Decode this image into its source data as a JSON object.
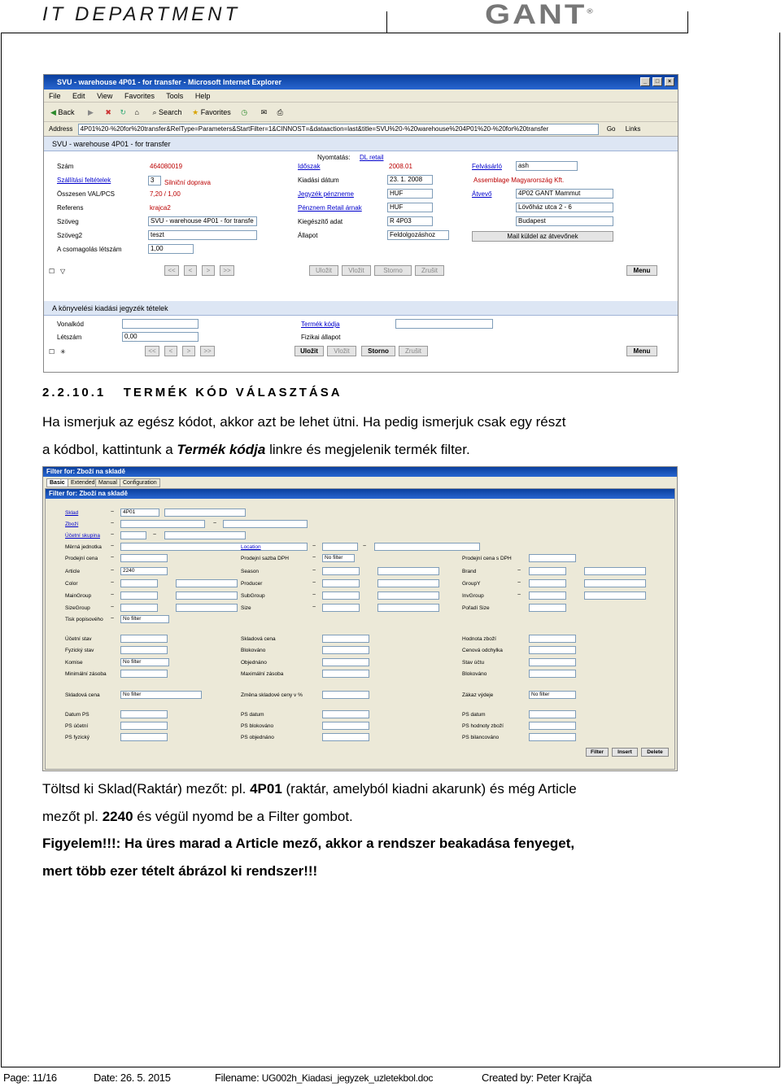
{
  "header": {
    "title": "IT DEPARTMENT",
    "logo": "GANT",
    "logo_reg": "®"
  },
  "shot1": {
    "window_title": "SVU - warehouse 4P01 - for transfer - Microsoft Internet Explorer",
    "menu": [
      "File",
      "Edit",
      "View",
      "Favorites",
      "Tools",
      "Help"
    ],
    "toolbar": [
      "Back",
      "Search",
      "Favorites"
    ],
    "address_label": "Address",
    "address_url": "4P01%20-%20for%20transfer&RelType=Parameters&StartFilter=1&CINNOST=&dataaction=last&title=SVU%20-%20warehouse%204P01%20-%20for%20transfer",
    "go": "Go",
    "links": "Links",
    "panel1_title": "SVU - warehouse 4P01 - for transfer",
    "print_label": "Nyomtatás:",
    "print_link": "DL retail",
    "left_labels": [
      "Szám",
      "Szállítási feltételek",
      "Összesen VAL/PCS",
      "Referens",
      "Szöveg",
      "Szöveg2",
      "A csomagolás létszám"
    ],
    "left_values": [
      "464080019",
      "3",
      "7,20 / 1,00",
      "krajca2",
      "SVU - warehouse 4P01 - for transfe",
      "teszt",
      "1,00"
    ],
    "left_extra": "Silniční doprava",
    "mid_labels": [
      "Időszak",
      "Kiadási dátum",
      "Jegyzék pénzneme",
      "Pénznem Retail árnak",
      "Kiegészítő adat",
      "Állapot"
    ],
    "mid_values": [
      "2008.01",
      "23. 1. 2008",
      "HUF",
      "HUF",
      "R 4P03",
      "Feldolgozáshoz"
    ],
    "right_labels": [
      "Felvásárló",
      "Assemblage Magyarország Kft.",
      "Átvevő"
    ],
    "right_values": [
      "ash",
      "4P02 GANT Mammut",
      "Lövőház utca 2 - 6",
      "Budapest"
    ],
    "mail_btn": "Mail küldel az átvevőnek",
    "nav": [
      "<<",
      "<",
      ">",
      ">>"
    ],
    "btns1": [
      "Uložit",
      "Vložit",
      "Storno",
      "Zrušit"
    ],
    "menu_btn": "Menu",
    "panel2_title": "A könyvelési kiadási jegyzék tételek",
    "p2_labels": [
      "Vonalkód",
      "Létszám"
    ],
    "p2_values": [
      "",
      "0,00"
    ],
    "p2_mid": [
      "Termék kódja",
      "Fizikai állapot"
    ],
    "btns2": [
      "Uložit",
      "Vložit",
      "Storno",
      "Zrušit"
    ]
  },
  "section": {
    "number": "2.2.10.1",
    "title": "TERMÉK KÓD VÁLASZTÁSA"
  },
  "para1": {
    "l1": "Ha ismerjuk az egész kódot, akkor azt be lehet ütni. Ha pedig ismerjuk csak egy részt",
    "l2a": "a kódbol, kattintunk a ",
    "l2b": "Termék kódja",
    "l2c": " linkre és megjelenik termék filter."
  },
  "shot2": {
    "title": "Filter for: Zboží na skladě",
    "tabs": [
      "Basic",
      "Extended",
      "Manual",
      "Configuration"
    ],
    "subtitle": "Filter for: Zboží na skladě",
    "col1": [
      "Sklad",
      "Zboží",
      "Účetní skupina",
      "Měrná jednotka",
      "Prodejní cena",
      "Article",
      "Color",
      "MainGroup",
      "SizeGroup",
      "Tisk popisového",
      "Účetní stav",
      "Fyzický stav",
      "Komise",
      "Minimální zásoba",
      "Skladová cena",
      "Datum PS",
      "PS účetní",
      "PS fyzický"
    ],
    "col2": [
      "Location",
      "Prodejní sazba DPH",
      "Season",
      "Producer",
      "SubGroup",
      "Size",
      "Skladová cena",
      "Blokováno",
      "Objednáno",
      "Maximální zásoba",
      "Změna skladové ceny v %",
      "PS datum",
      "PS blokováno",
      "PS objednáno"
    ],
    "col3": [
      "Prodejní cena s DPH",
      "Brand",
      "GroupY",
      "InvGroup",
      "Pořadí Size",
      "Hodnota zboží",
      "Cenová odchylka",
      "Stav účtu",
      "Blokováno",
      "Zákaz výdeje",
      "PS datum",
      "PS hodnoty zboží",
      "PS bilancováno"
    ],
    "v_sklad": "4P01",
    "v_article": "2240",
    "nofilter": "No filter",
    "buttons": [
      "Filter",
      "Insert",
      "Delete"
    ]
  },
  "para2": {
    "l1a": "Töltsd ki Sklad(Raktár) mezőt: pl. ",
    "l1b": "4P01",
    "l1c": " (raktár, amelyból kiadni akarunk) és még Article",
    "l2a": "mezőt pl. ",
    "l2b": "2240",
    "l2c": " és végül nyomd be a Filter gombot.",
    "l3": "Figyelem!!!: Ha üres marad a Article mező, akkor a rendszer beakadása fenyeget,",
    "l4": "mert több ezer tételt ábrázol ki rendszer!!!"
  },
  "footer": {
    "page": "Page: 11/16",
    "date": "Date: 26. 5. 2015",
    "filename_label": "Filename: ",
    "filename": "UG002h_Kiadasi_jegyzek_uzletekbol.doc",
    "created": "Created by: Peter Krajča"
  }
}
